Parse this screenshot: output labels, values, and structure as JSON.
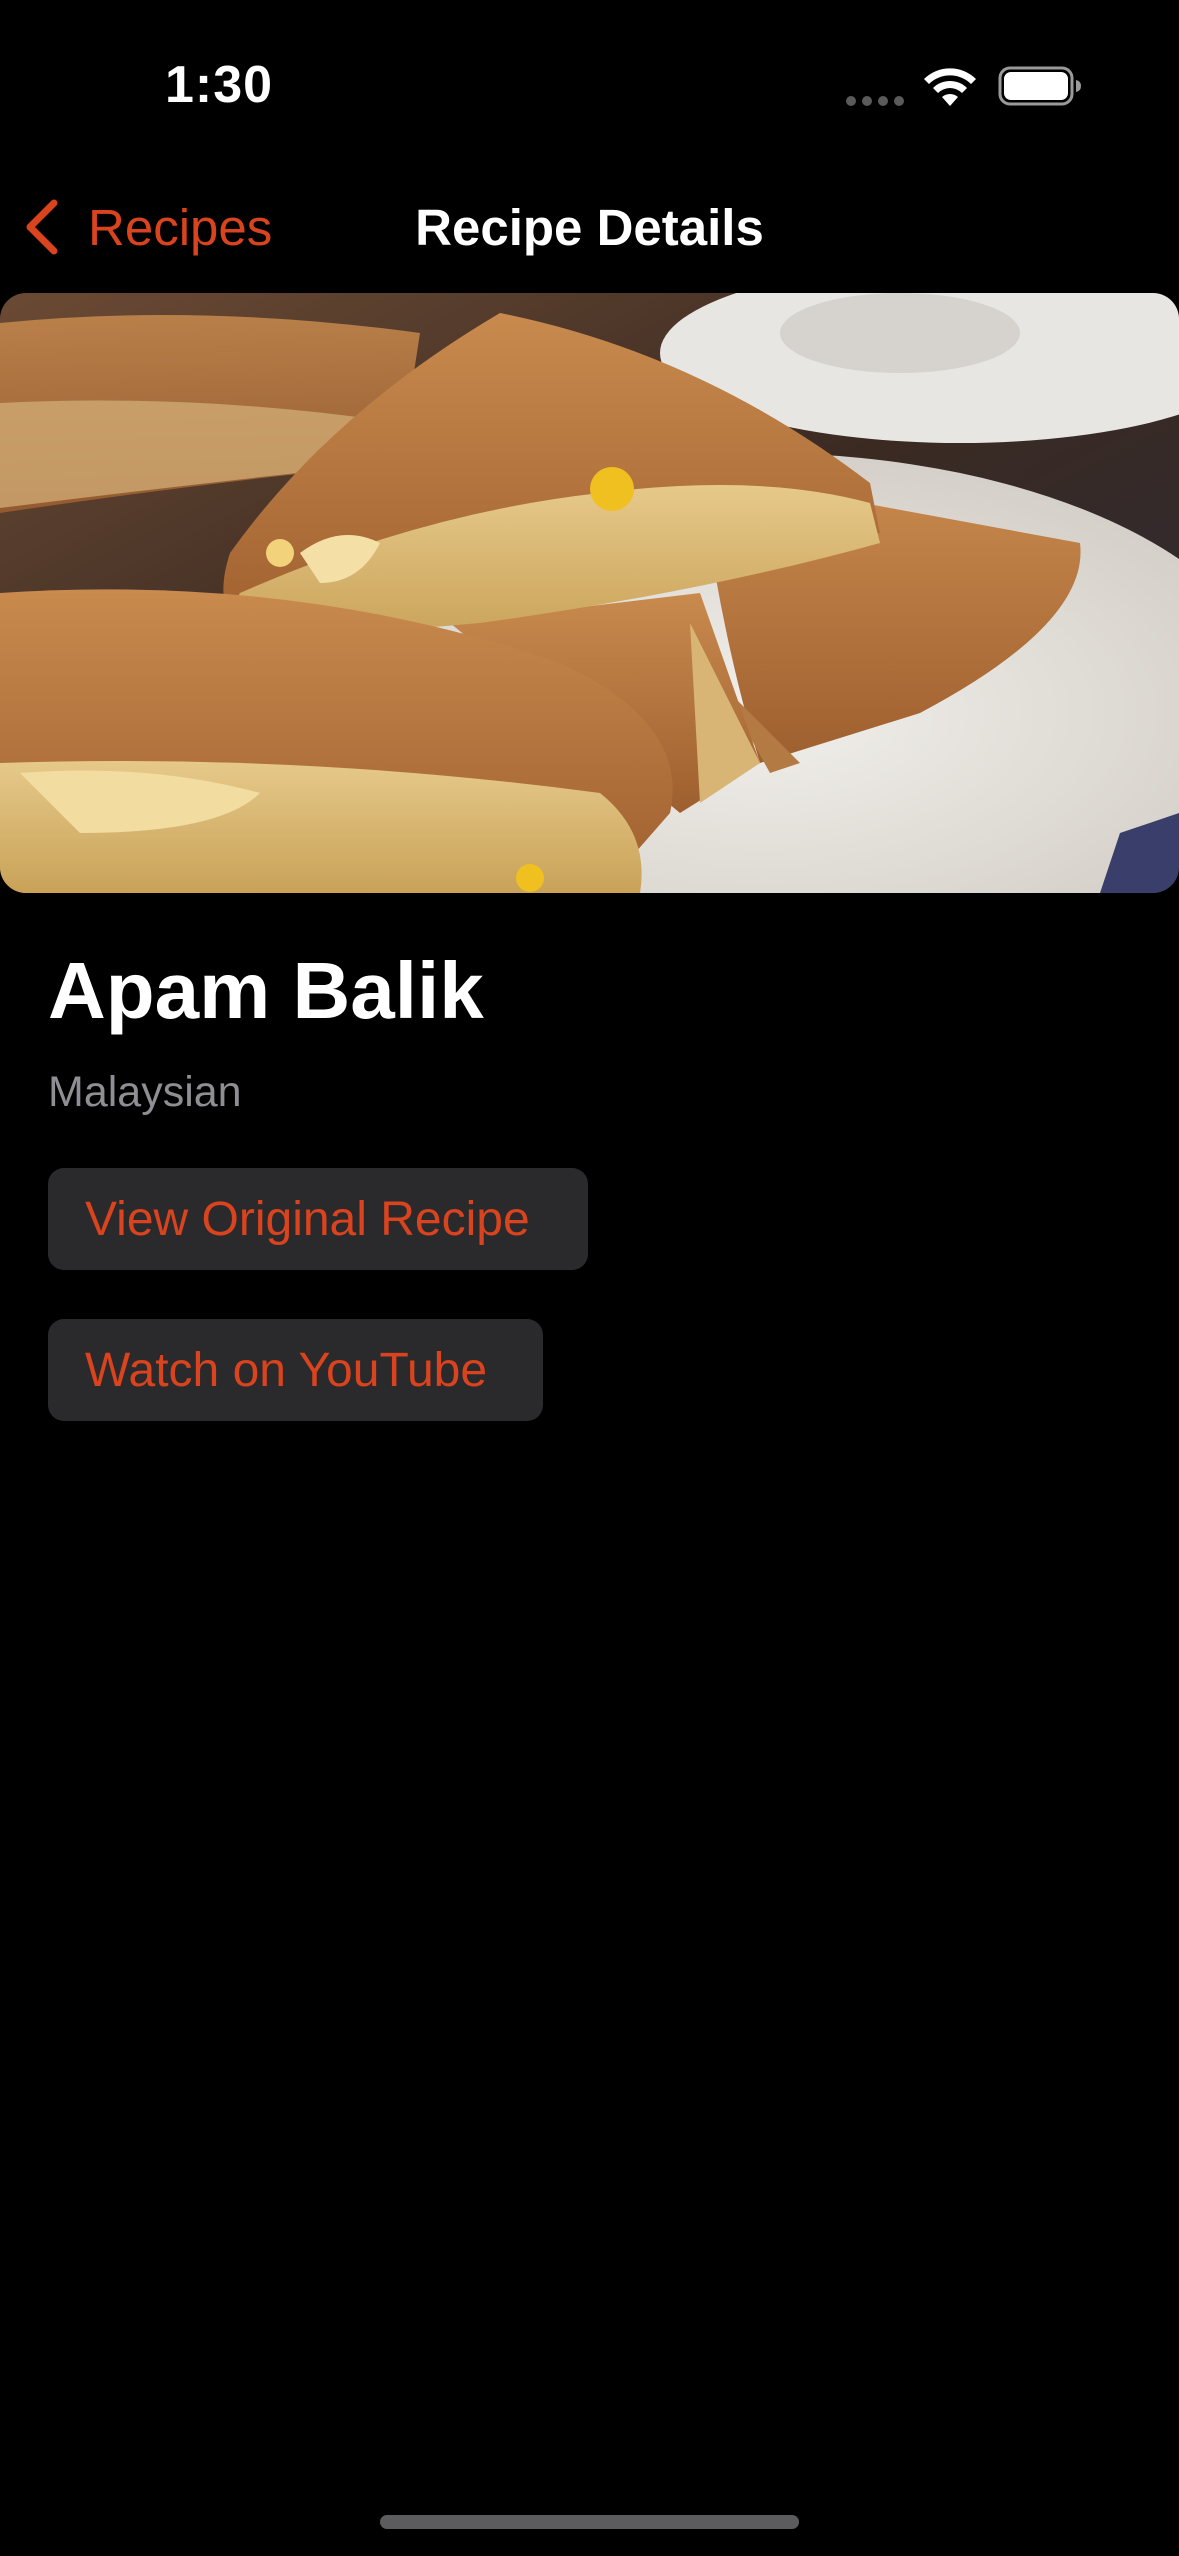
{
  "status_bar": {
    "time": "1:30",
    "icons": [
      "cellular-dots-icon",
      "wifi-icon",
      "battery-icon"
    ]
  },
  "nav": {
    "back_label": "Recipes",
    "title": "Recipe Details",
    "back_icon": "chevron-left-icon"
  },
  "recipe": {
    "name": "Apam Balik",
    "cuisine": "Malaysian",
    "image": "recipe-photo"
  },
  "actions": {
    "original_recipe_label": "View Original Recipe",
    "youtube_label": "Watch on YouTube"
  },
  "colors": {
    "accent": "#d9431e",
    "background": "#000000",
    "button_background": "#2a2a2c",
    "secondary_text": "#8e8e93"
  }
}
